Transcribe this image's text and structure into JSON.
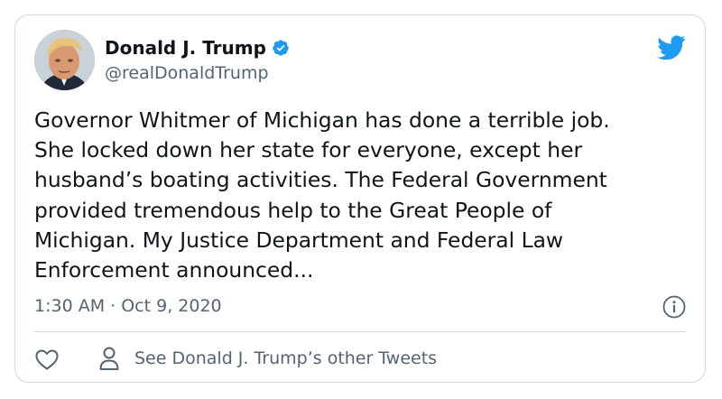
{
  "author": {
    "name": "Donald J. Trump",
    "handle": "@realDonaldTrump",
    "verified": true,
    "avatar_icon": "profile-photo"
  },
  "tweet": {
    "lines": [
      "Governor Whitmer of Michigan has done a terrible job.",
      "She locked down her state for everyone, except her",
      "husband’s boating activities. The Federal Government",
      "provided tremendous help to the Great People of",
      "Michigan. My Justice Department and Federal Law",
      "Enforcement announced..."
    ],
    "timestamp": "1:30 AM · Oct 9, 2020"
  },
  "footer": {
    "see_other_label": "See Donald J. Trump’s other Tweets"
  },
  "colors": {
    "twitter_blue": "#1d9bf0",
    "text": "#0f1419",
    "secondary": "#536471",
    "border": "#cfd9de"
  },
  "icons": {
    "brand": "twitter-bird-icon",
    "verified": "verified-badge-icon",
    "info": "info-icon",
    "like": "heart-icon",
    "profile": "person-icon"
  }
}
